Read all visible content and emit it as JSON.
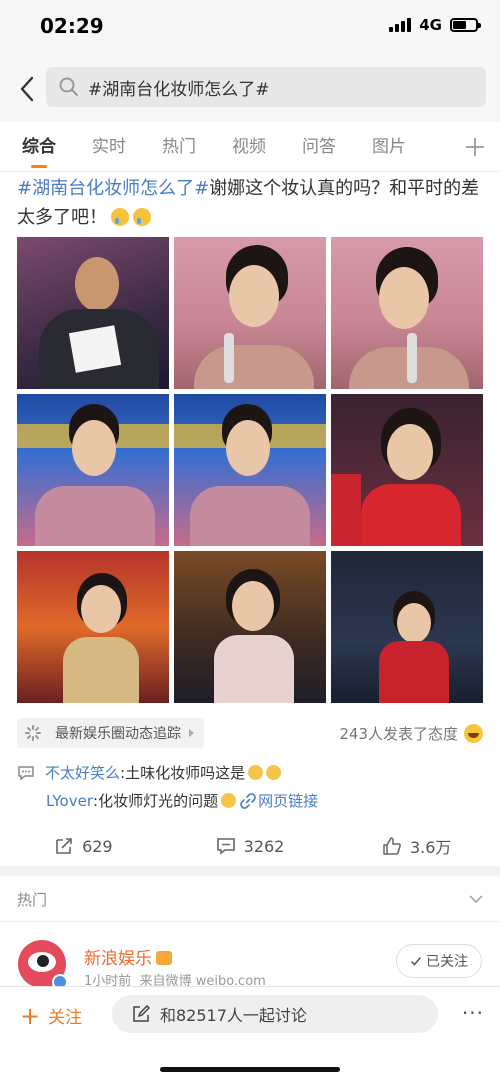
{
  "status": {
    "time": "02:29",
    "network": "4G",
    "battery_level": 0.6
  },
  "search": {
    "query": "#湖南台化妆师怎么了#"
  },
  "tabs": [
    "综合",
    "实时",
    "热门",
    "视频",
    "问答",
    "图片"
  ],
  "post": {
    "hashtag": "#湖南台化妆师怎么了#",
    "text": "谢娜这个妆认真的吗？和平时的差太多了吧！",
    "emojis": [
      "cry-emoji",
      "cry-emoji"
    ]
  },
  "source": {
    "label": "最新娱乐圈动态追踪",
    "attitude": "243人发表了态度"
  },
  "comments": [
    {
      "user": "不太好笑么",
      "sep": ": ",
      "text": "土味化妆师吗这是"
    },
    {
      "user": "LYover",
      "sep": ": ",
      "text": "化妆师灯光的问题",
      "link": "网页链接"
    }
  ],
  "actions": {
    "repost": "629",
    "comment": "3262",
    "like": "3.6万"
  },
  "hot": {
    "label": "热门"
  },
  "account": {
    "name": "新浪娱乐",
    "time": "1小时前",
    "from": "来自微博",
    "domain": "weibo.com",
    "follow_state": "已关注"
  },
  "bottom_bar": {
    "follow": "关注",
    "discuss": "和82517人一起讨论",
    "more": "···"
  },
  "colors": {
    "accent": "#ff8200",
    "link": "#4a7cc6",
    "name_orange": "#f06a30"
  }
}
